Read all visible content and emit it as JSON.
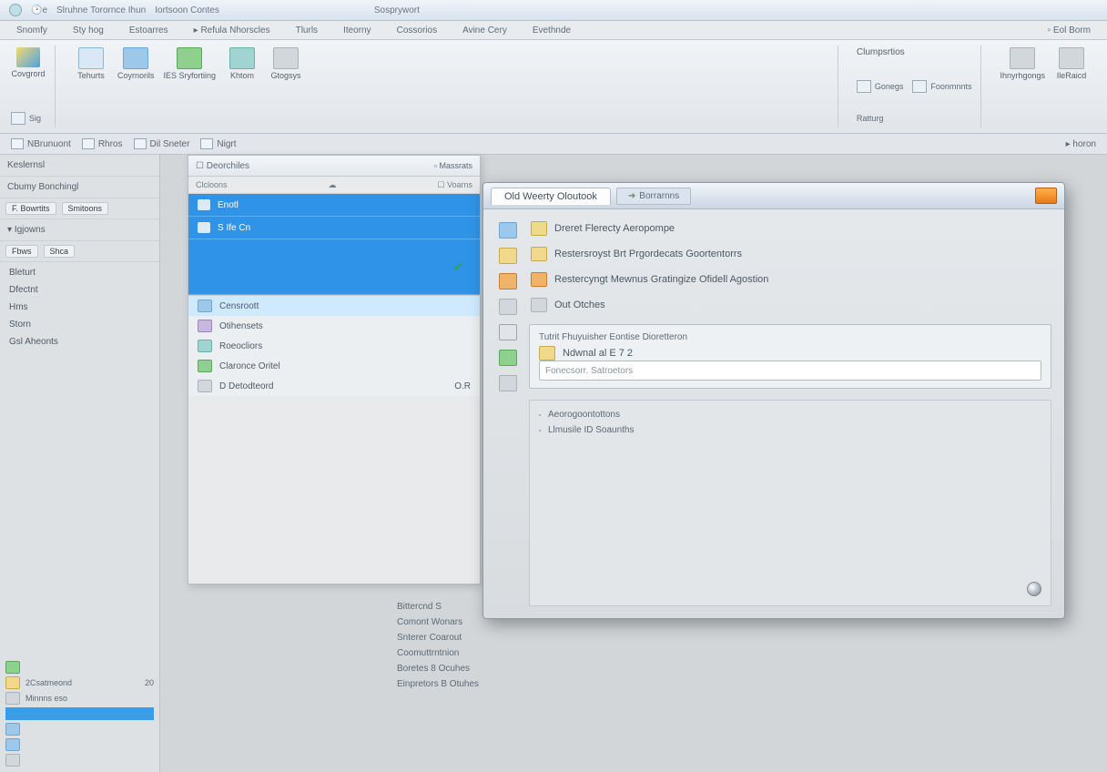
{
  "titlebar": {
    "app1": "Slruhne Torornce Ihun",
    "app2": "Iortsoon Contes",
    "app3": "Sosprywort"
  },
  "menubar": {
    "items": [
      "Snomfy",
      "Sty hog",
      "Estoarres",
      "Refula Nhorscles",
      "Tlurls",
      "Iteorny",
      "Cossorios",
      "Avine Cery",
      "Evethnde",
      "Eol Borm"
    ]
  },
  "ribbon": {
    "group1": {
      "big": "Covgrord",
      "sub": "Sig"
    },
    "group2": {
      "items": [
        "Tehurts",
        "Coyrnorils",
        "IES Sryfortiing",
        "Khtom",
        "Gtogsys"
      ]
    },
    "group3": {
      "title": "Clumpsrtios",
      "items": [
        "Gonegs",
        "Foonmnnts"
      ],
      "sub": "Ratturg"
    },
    "group4": {
      "items": [
        "Ihnyrhgongs",
        "IleRaicd"
      ]
    }
  },
  "quickbar": {
    "items": [
      "NBrunuont",
      "Rhros",
      "Dil Sneter",
      "Nigrt"
    ],
    "right": "horon"
  },
  "left": {
    "sect1": "Keslernsl",
    "sect2": "Cbumy Bonchingl",
    "tabs": [
      "F. Bowrtits",
      "Smitoons"
    ],
    "tree_hdr": "Igjowns",
    "tabs2": [
      "Fbws",
      "Shca"
    ],
    "nav": [
      "Bleturt",
      "Dfectnt",
      "Hms",
      "Storn",
      "Gsl Aheonts"
    ],
    "icons": [
      {
        "label": "2Csatmeond",
        "count": "20"
      },
      {
        "label": "Minnns  eso"
      },
      {
        "label": ""
      },
      {
        "label": ""
      },
      {
        "label": ""
      }
    ]
  },
  "midpanel": {
    "title": "Deorchiles",
    "tool_l": "Clcloons",
    "tool_r": "Voarns",
    "bluelist": [
      "Enotl",
      "S Ife Cn"
    ],
    "graylist": [
      {
        "t": "Censroott",
        "sel": true
      },
      {
        "t": "Otihensets"
      },
      {
        "t": "Roeocliors"
      },
      {
        "t": "Claronce Oritel"
      },
      {
        "t": "D Detodteord",
        "r": "O.R"
      }
    ],
    "below": [
      "Bittercnd S",
      "Comont Wonars",
      "Snterer Coarout",
      "Coomuttrntnion",
      "Boretes 8 Ocuhes",
      "Einpretors B Otuhes"
    ]
  },
  "dialog": {
    "title": "Old Weerty Oloutook",
    "tab2": "Borrarnns",
    "rows": [
      "Dreret Flerecty Aeropompe",
      "Restersroyst Brt Prgordecats Goortentorrs",
      "Restercyngt Mewnus Gratingize Ofidell Agostion",
      "Out Otches"
    ],
    "frame": {
      "title": "Tutrit Fhuyuisher Eontise Dioretteron",
      "line1": "Ndwnal al E 7 2",
      "placeholder": "Fonecsorr. Satroetors"
    },
    "rest": {
      "line1": "Aeorogoontottons",
      "line2": "Llmusile ID Soaunths"
    }
  }
}
